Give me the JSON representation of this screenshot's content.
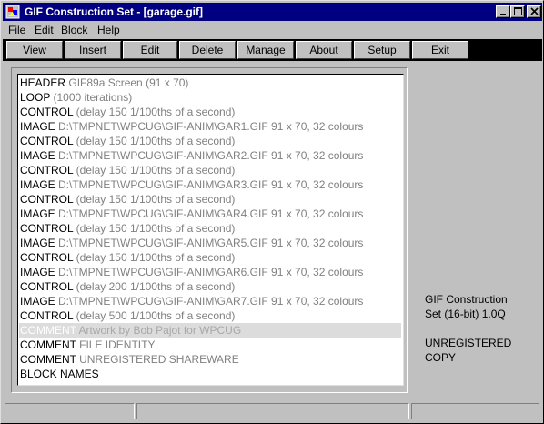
{
  "window": {
    "title": "GIF Construction Set - [garage.gif]",
    "title_bar_color": "#000080"
  },
  "menu": {
    "items": [
      {
        "label": "File"
      },
      {
        "label": "Edit"
      },
      {
        "label": "Block"
      },
      {
        "label": "Help"
      }
    ]
  },
  "toolbar": {
    "buttons": [
      {
        "label": "View"
      },
      {
        "label": "Insert"
      },
      {
        "label": "Edit"
      },
      {
        "label": "Delete"
      },
      {
        "label": "Manage"
      },
      {
        "label": "About"
      },
      {
        "label": "Setup"
      },
      {
        "label": "Exit"
      }
    ]
  },
  "blocks": [
    {
      "type": "HEADER",
      "detail": "GIF89a Screen (91 x 70)"
    },
    {
      "type": "LOOP",
      "detail": "(1000 iterations)"
    },
    {
      "type": "CONTROL",
      "detail": "(delay 150 1/100ths of a second)"
    },
    {
      "type": "IMAGE",
      "detail": "D:\\TMPNET\\WPCUG\\GIF-ANIM\\GAR1.GIF 91 x 70, 32 colours"
    },
    {
      "type": "CONTROL",
      "detail": "(delay 150 1/100ths of a second)"
    },
    {
      "type": "IMAGE",
      "detail": "D:\\TMPNET\\WPCUG\\GIF-ANIM\\GAR2.GIF 91 x 70, 32 colours"
    },
    {
      "type": "CONTROL",
      "detail": "(delay 150 1/100ths of a second)"
    },
    {
      "type": "IMAGE",
      "detail": "D:\\TMPNET\\WPCUG\\GIF-ANIM\\GAR3.GIF 91 x 70, 32 colours"
    },
    {
      "type": "CONTROL",
      "detail": "(delay 150 1/100ths of a second)"
    },
    {
      "type": "IMAGE",
      "detail": "D:\\TMPNET\\WPCUG\\GIF-ANIM\\GAR4.GIF 91 x 70, 32 colours"
    },
    {
      "type": "CONTROL",
      "detail": "(delay 150 1/100ths of a second)"
    },
    {
      "type": "IMAGE",
      "detail": "D:\\TMPNET\\WPCUG\\GIF-ANIM\\GAR5.GIF 91 x 70, 32 colours"
    },
    {
      "type": "CONTROL",
      "detail": "(delay 150 1/100ths of a second)"
    },
    {
      "type": "IMAGE",
      "detail": "D:\\TMPNET\\WPCUG\\GIF-ANIM\\GAR6.GIF 91 x 70, 32 colours"
    },
    {
      "type": "CONTROL",
      "detail": "(delay 200 1/100ths of a second)"
    },
    {
      "type": "IMAGE",
      "detail": "D:\\TMPNET\\WPCUG\\GIF-ANIM\\GAR7.GIF 91 x 70, 32 colours"
    },
    {
      "type": "CONTROL",
      "detail": "(delay 500 1/100ths of a second)"
    },
    {
      "type": "COMMENT",
      "detail": "Artwork by Bob Pajot for WPCUG",
      "selected": true
    },
    {
      "type": "COMMENT",
      "detail": "FILE IDENTITY"
    },
    {
      "type": "COMMENT",
      "detail": "UNREGISTERED SHAREWARE"
    },
    {
      "type": "BLOCK NAMES",
      "detail": ""
    }
  ],
  "info": {
    "product_line1": "GIF Construction",
    "product_line2": "Set (16-bit) 1.0Q",
    "registration_line1": "UNREGISTERED",
    "registration_line2": "COPY"
  },
  "colors": {
    "selection": "#dcdcdc",
    "detail_text": "#808080",
    "face": "#c0c0c0"
  }
}
